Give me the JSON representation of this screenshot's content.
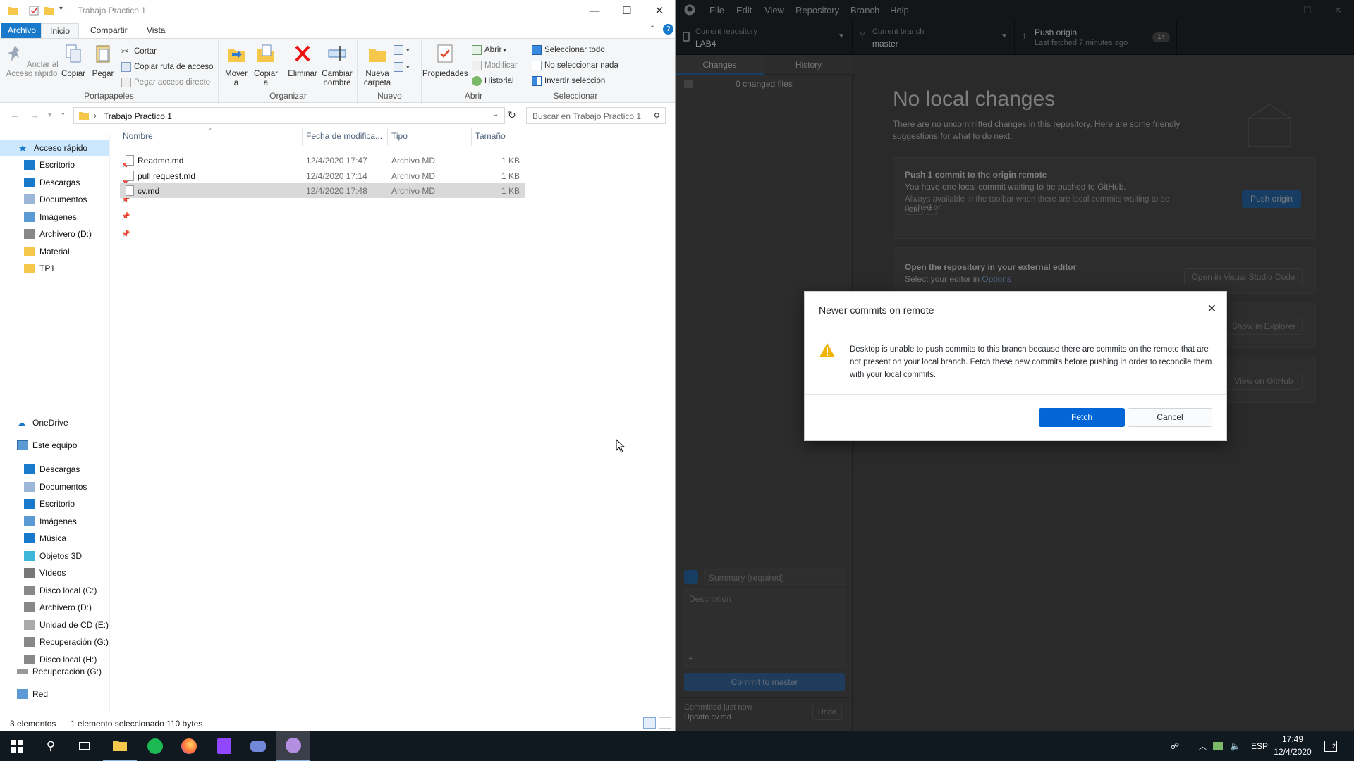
{
  "explorer": {
    "title": "Trabajo Practico 1",
    "ribbon_tabs": [
      "Archivo",
      "Inicio",
      "Compartir",
      "Vista"
    ],
    "groups": {
      "portapapeles": {
        "label": "Portapapeles",
        "anclar": "Anclar al Acceso rápido",
        "copiar": "Copiar",
        "pegar": "Pegar",
        "cortar": "Cortar",
        "copiar_ruta": "Copiar ruta de acceso",
        "pegar_acceso": "Pegar acceso directo"
      },
      "organizar": {
        "label": "Organizar",
        "mover": "Mover a",
        "copiar_a": "Copiar a",
        "eliminar": "Eliminar",
        "cambiar": "Cambiar nombre"
      },
      "nuevo": {
        "label": "Nuevo",
        "nueva_carpeta": "Nueva carpeta"
      },
      "abrir": {
        "label": "Abrir",
        "propiedades": "Propiedades",
        "abrir": "Abrir",
        "modificar": "Modificar",
        "historial": "Historial"
      },
      "seleccionar": {
        "label": "Seleccionar",
        "todo": "Seleccionar todo",
        "nada": "No seleccionar nada",
        "invertir": "Invertir selección"
      }
    },
    "address": "Trabajo Practico 1",
    "search_placeholder": "Buscar en Trabajo Practico 1",
    "nav": {
      "acceso_rapido": "Acceso rápido",
      "quick": [
        "Escritorio",
        "Descargas",
        "Documentos",
        "Imágenes",
        "Archivero (D:)",
        "Material",
        "TP1"
      ],
      "onedrive": "OneDrive",
      "este_equipo": "Este equipo",
      "pc": [
        "Descargas",
        "Documentos",
        "Escritorio",
        "Imágenes",
        "Música",
        "Objetos 3D",
        "Vídeos",
        "Disco local (C:)",
        "Archivero (D:)",
        "Unidad de CD (E:)",
        "Recuperación (G:)",
        "Disco local (H:)"
      ],
      "recuperacion": "Recuperación (G:)",
      "red": "Red"
    },
    "columns": {
      "nombre": "Nombre",
      "fecha": "Fecha de modifica...",
      "tipo": "Tipo",
      "tamano": "Tamaño"
    },
    "files": [
      {
        "name": "Readme.md",
        "date": "12/4/2020 17:47",
        "type": "Archivo MD",
        "size": "1 KB"
      },
      {
        "name": "pull request.md",
        "date": "12/4/2020 17:14",
        "type": "Archivo MD",
        "size": "1 KB"
      },
      {
        "name": "cv.md",
        "date": "12/4/2020 17:48",
        "type": "Archivo MD",
        "size": "1 KB"
      }
    ],
    "status": {
      "count": "3 elementos",
      "selected": "1 elemento seleccionado  110 bytes"
    }
  },
  "github": {
    "menu": [
      "File",
      "Edit",
      "View",
      "Repository",
      "Branch",
      "Help"
    ],
    "repo": {
      "label": "Current repository",
      "value": "LAB4"
    },
    "branch": {
      "label": "Current branch",
      "value": "master"
    },
    "push": {
      "label": "Push origin",
      "sub": "Last fetched 7 minutes ago",
      "badge": "1↑"
    },
    "tabs": {
      "changes": "Changes",
      "history": "History"
    },
    "changed_files": "0 changed files",
    "summary_placeholder": "Summary (required)",
    "description_placeholder": "Description",
    "commit_button": "Commit to master",
    "last_commit": {
      "when": "Committed just now",
      "message": "Update cv.md",
      "undo": "Undo"
    },
    "main": {
      "title": "No local changes",
      "subtitle": "There are no uncommitted changes in this repository. Here are some friendly suggestions for what to do next.",
      "push_card": {
        "title": "Push 1 commit to the origin remote",
        "line1": "You have one local commit waiting to be pushed to GitHub.",
        "line2": "Always available in the toolbar when there are local commits waiting to be pushed or",
        "key1": "Ctrl",
        "key2": "P",
        "button": "Push origin"
      },
      "editor_card": {
        "title": "Open the repository in your external editor",
        "line1": "Select your editor in ",
        "link": "Options",
        "button": "Open in Visual Studio Code"
      },
      "explorer_button": "Show in Explorer",
      "github_button": "View on GitHub"
    }
  },
  "dialog": {
    "title": "Newer commits on remote",
    "message": "Desktop is unable to push commits to this branch because there are commits on the remote that are not present on your local branch. Fetch these new commits before pushing in order to reconcile them with your local commits.",
    "fetch": "Fetch",
    "cancel": "Cancel"
  },
  "taskbar": {
    "lang": "ESP",
    "time": "17:49",
    "date": "12/4/2020",
    "notif_count": "2"
  }
}
